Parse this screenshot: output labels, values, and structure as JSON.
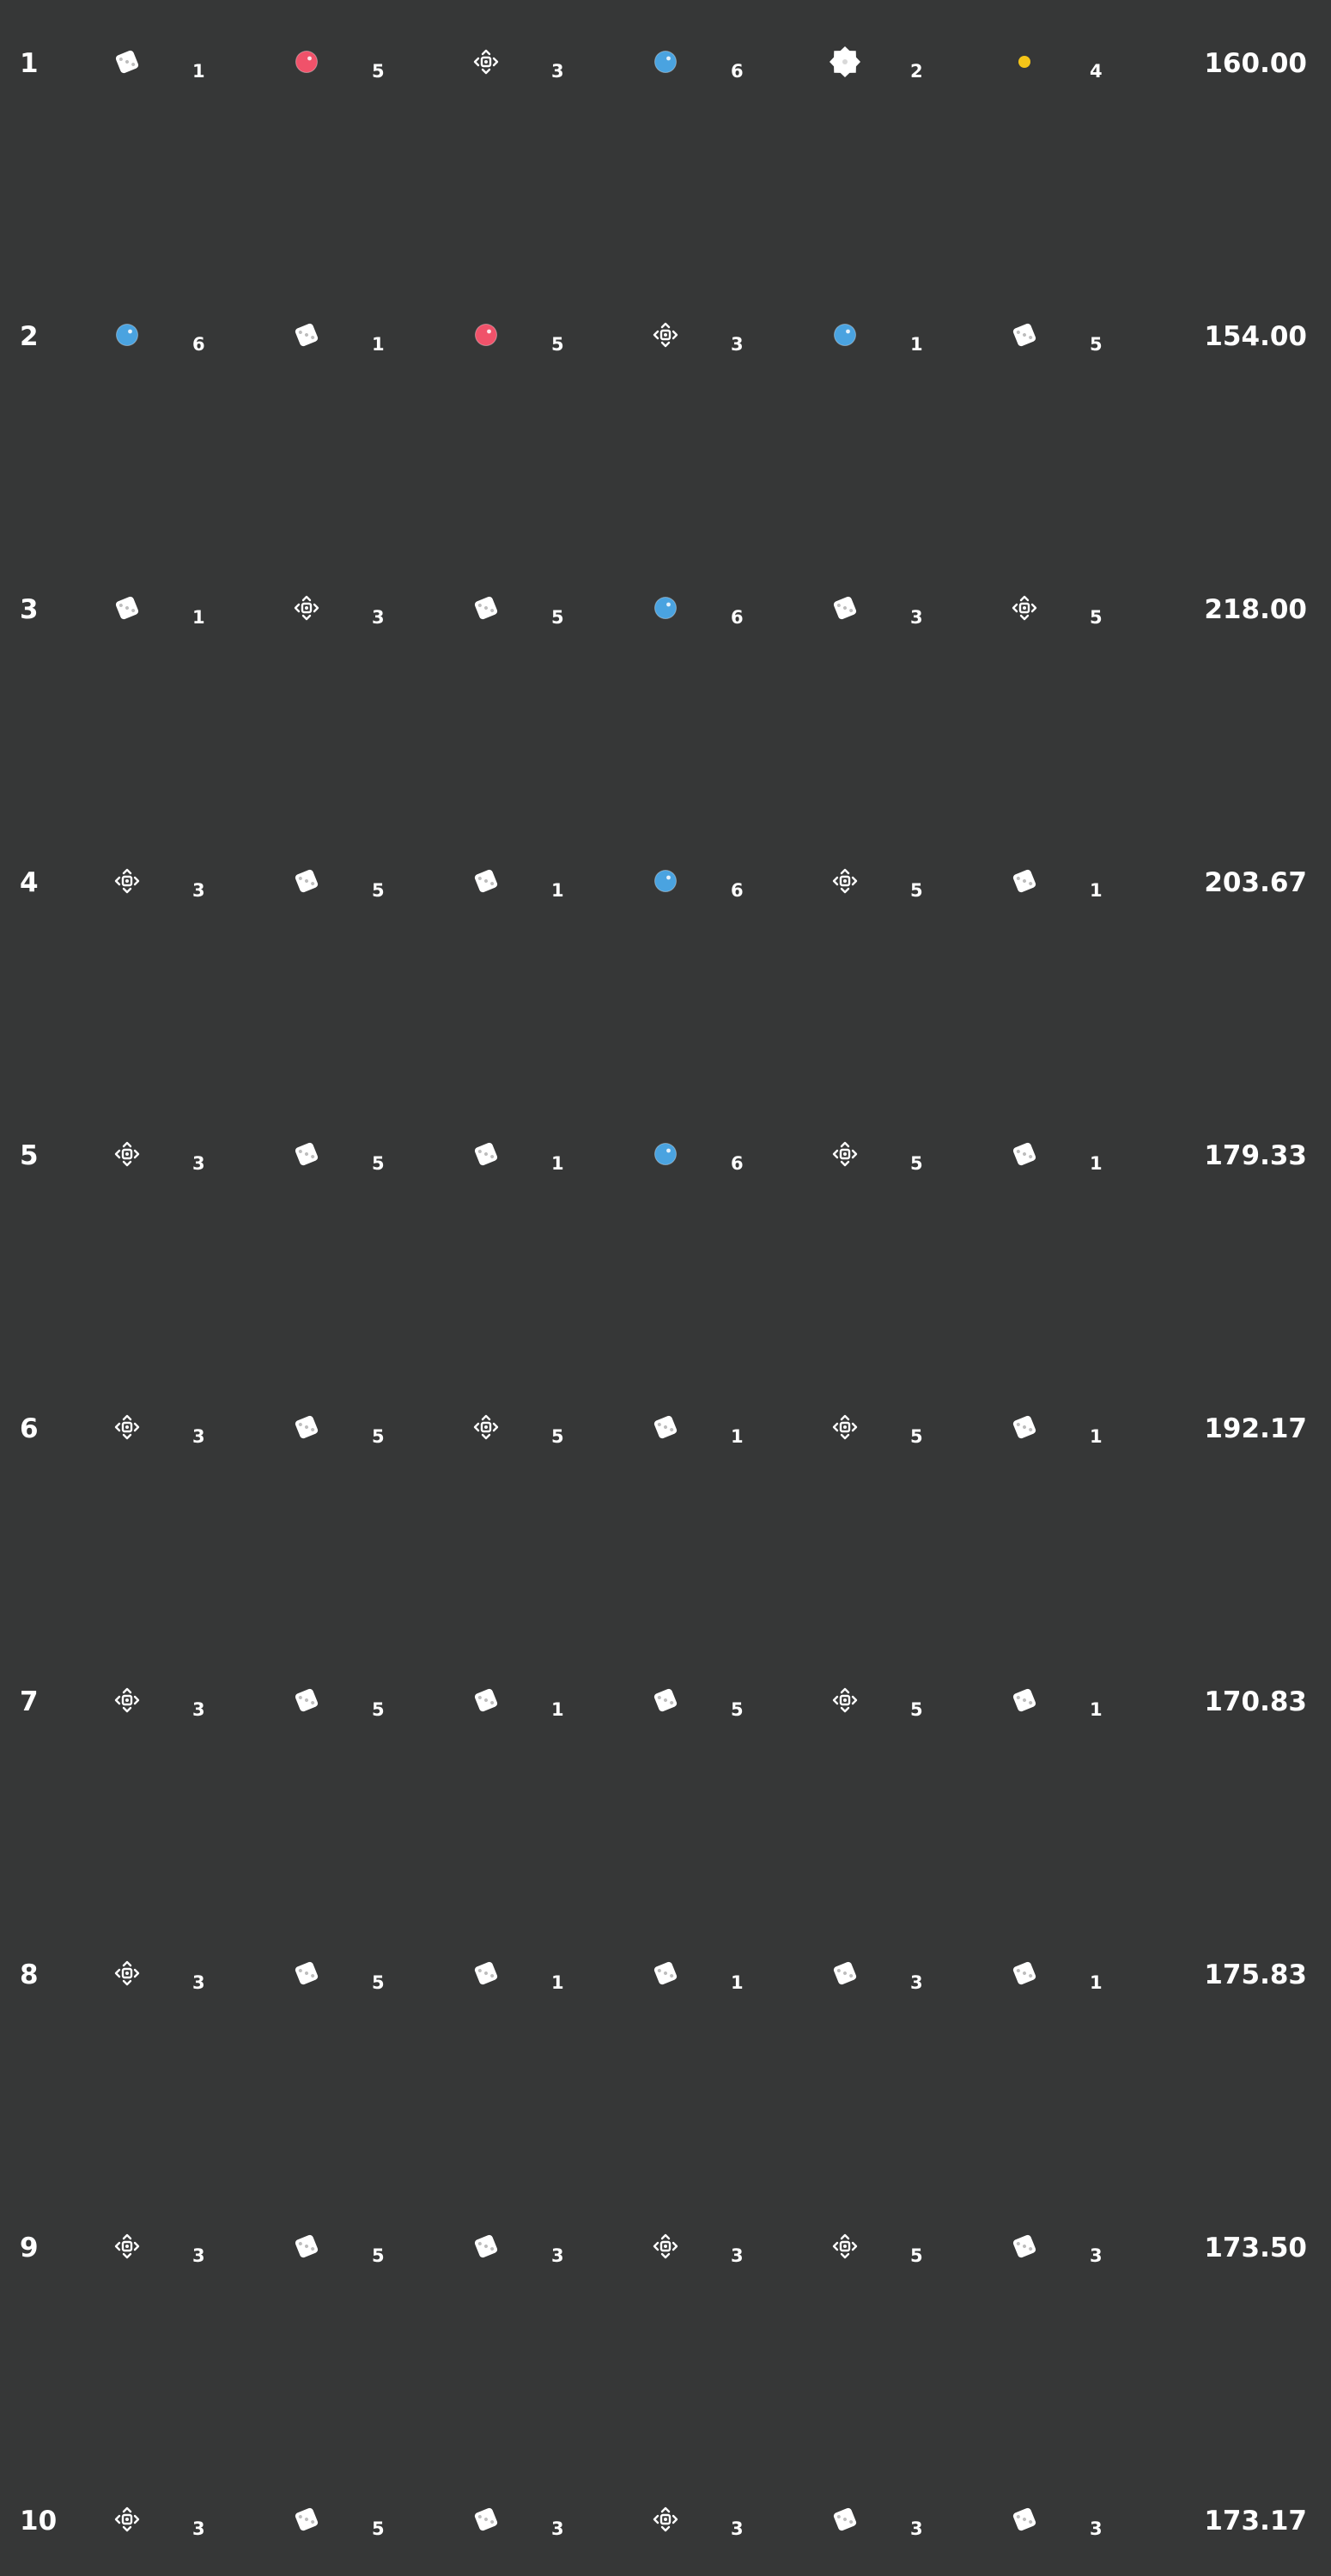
{
  "colors": {
    "background": "#363737",
    "text": "#ffffff",
    "red_orb": "#f0526a",
    "blue_orb": "#4aa3e0",
    "yellow_dot": "#f5c518"
  },
  "rows": [
    {
      "rank": "1",
      "score": "160.00",
      "slots": [
        {
          "icon": "white-die-icon",
          "count": "1"
        },
        {
          "icon": "red-orb-icon",
          "count": "5"
        },
        {
          "icon": "move-arrows-icon",
          "count": "3"
        },
        {
          "icon": "blue-orb-icon",
          "count": "6"
        },
        {
          "icon": "white-burst-icon",
          "count": "2"
        },
        {
          "icon": "yellow-dot-icon",
          "count": "4"
        }
      ]
    },
    {
      "rank": "2",
      "score": "154.00",
      "slots": [
        {
          "icon": "blue-orb-icon",
          "count": "6"
        },
        {
          "icon": "white-die-icon",
          "count": "1"
        },
        {
          "icon": "red-orb-icon",
          "count": "5"
        },
        {
          "icon": "move-arrows-icon",
          "count": "3"
        },
        {
          "icon": "blue-orb-icon",
          "count": "1"
        },
        {
          "icon": "white-die-icon",
          "count": "5"
        }
      ]
    },
    {
      "rank": "3",
      "score": "218.00",
      "slots": [
        {
          "icon": "white-die-icon",
          "count": "1"
        },
        {
          "icon": "move-arrows-icon",
          "count": "3"
        },
        {
          "icon": "white-die-icon",
          "count": "5"
        },
        {
          "icon": "blue-orb-icon",
          "count": "6"
        },
        {
          "icon": "white-die-icon",
          "count": "3"
        },
        {
          "icon": "move-arrows-icon",
          "count": "5"
        }
      ]
    },
    {
      "rank": "4",
      "score": "203.67",
      "slots": [
        {
          "icon": "move-arrows-icon",
          "count": "3"
        },
        {
          "icon": "white-die-icon",
          "count": "5"
        },
        {
          "icon": "white-die-icon",
          "count": "1"
        },
        {
          "icon": "blue-orb-icon",
          "count": "6"
        },
        {
          "icon": "move-arrows-icon",
          "count": "5"
        },
        {
          "icon": "white-die-icon",
          "count": "1"
        }
      ]
    },
    {
      "rank": "5",
      "score": "179.33",
      "slots": [
        {
          "icon": "move-arrows-icon",
          "count": "3"
        },
        {
          "icon": "white-die-icon",
          "count": "5"
        },
        {
          "icon": "white-die-icon",
          "count": "1"
        },
        {
          "icon": "blue-orb-icon",
          "count": "6"
        },
        {
          "icon": "move-arrows-icon",
          "count": "5"
        },
        {
          "icon": "white-die-icon",
          "count": "1"
        }
      ]
    },
    {
      "rank": "6",
      "score": "192.17",
      "slots": [
        {
          "icon": "move-arrows-icon",
          "count": "3"
        },
        {
          "icon": "white-die-icon",
          "count": "5"
        },
        {
          "icon": "move-arrows-icon",
          "count": "5"
        },
        {
          "icon": "white-die-icon",
          "count": "1"
        },
        {
          "icon": "move-arrows-icon",
          "count": "5"
        },
        {
          "icon": "white-die-icon",
          "count": "1"
        }
      ]
    },
    {
      "rank": "7",
      "score": "170.83",
      "slots": [
        {
          "icon": "move-arrows-icon",
          "count": "3"
        },
        {
          "icon": "white-die-icon",
          "count": "5"
        },
        {
          "icon": "white-die-icon",
          "count": "1"
        },
        {
          "icon": "white-die-icon",
          "count": "5"
        },
        {
          "icon": "move-arrows-icon",
          "count": "5"
        },
        {
          "icon": "white-die-icon",
          "count": "1"
        }
      ]
    },
    {
      "rank": "8",
      "score": "175.83",
      "slots": [
        {
          "icon": "move-arrows-icon",
          "count": "3"
        },
        {
          "icon": "white-die-icon",
          "count": "5"
        },
        {
          "icon": "white-die-icon",
          "count": "1"
        },
        {
          "icon": "white-die-icon",
          "count": "1"
        },
        {
          "icon": "white-die-icon",
          "count": "3"
        },
        {
          "icon": "white-die-icon",
          "count": "1"
        }
      ]
    },
    {
      "rank": "9",
      "score": "173.50",
      "slots": [
        {
          "icon": "move-arrows-icon",
          "count": "3"
        },
        {
          "icon": "white-die-icon",
          "count": "5"
        },
        {
          "icon": "white-die-icon",
          "count": "3"
        },
        {
          "icon": "move-arrows-icon",
          "count": "3"
        },
        {
          "icon": "move-arrows-icon",
          "count": "5"
        },
        {
          "icon": "white-die-icon",
          "count": "3"
        }
      ]
    },
    {
      "rank": "10",
      "score": "173.17",
      "slots": [
        {
          "icon": "move-arrows-icon",
          "count": "3"
        },
        {
          "icon": "white-die-icon",
          "count": "5"
        },
        {
          "icon": "white-die-icon",
          "count": "3"
        },
        {
          "icon": "move-arrows-icon",
          "count": "3"
        },
        {
          "icon": "white-die-icon",
          "count": "3"
        },
        {
          "icon": "white-die-icon",
          "count": "3"
        }
      ]
    }
  ]
}
